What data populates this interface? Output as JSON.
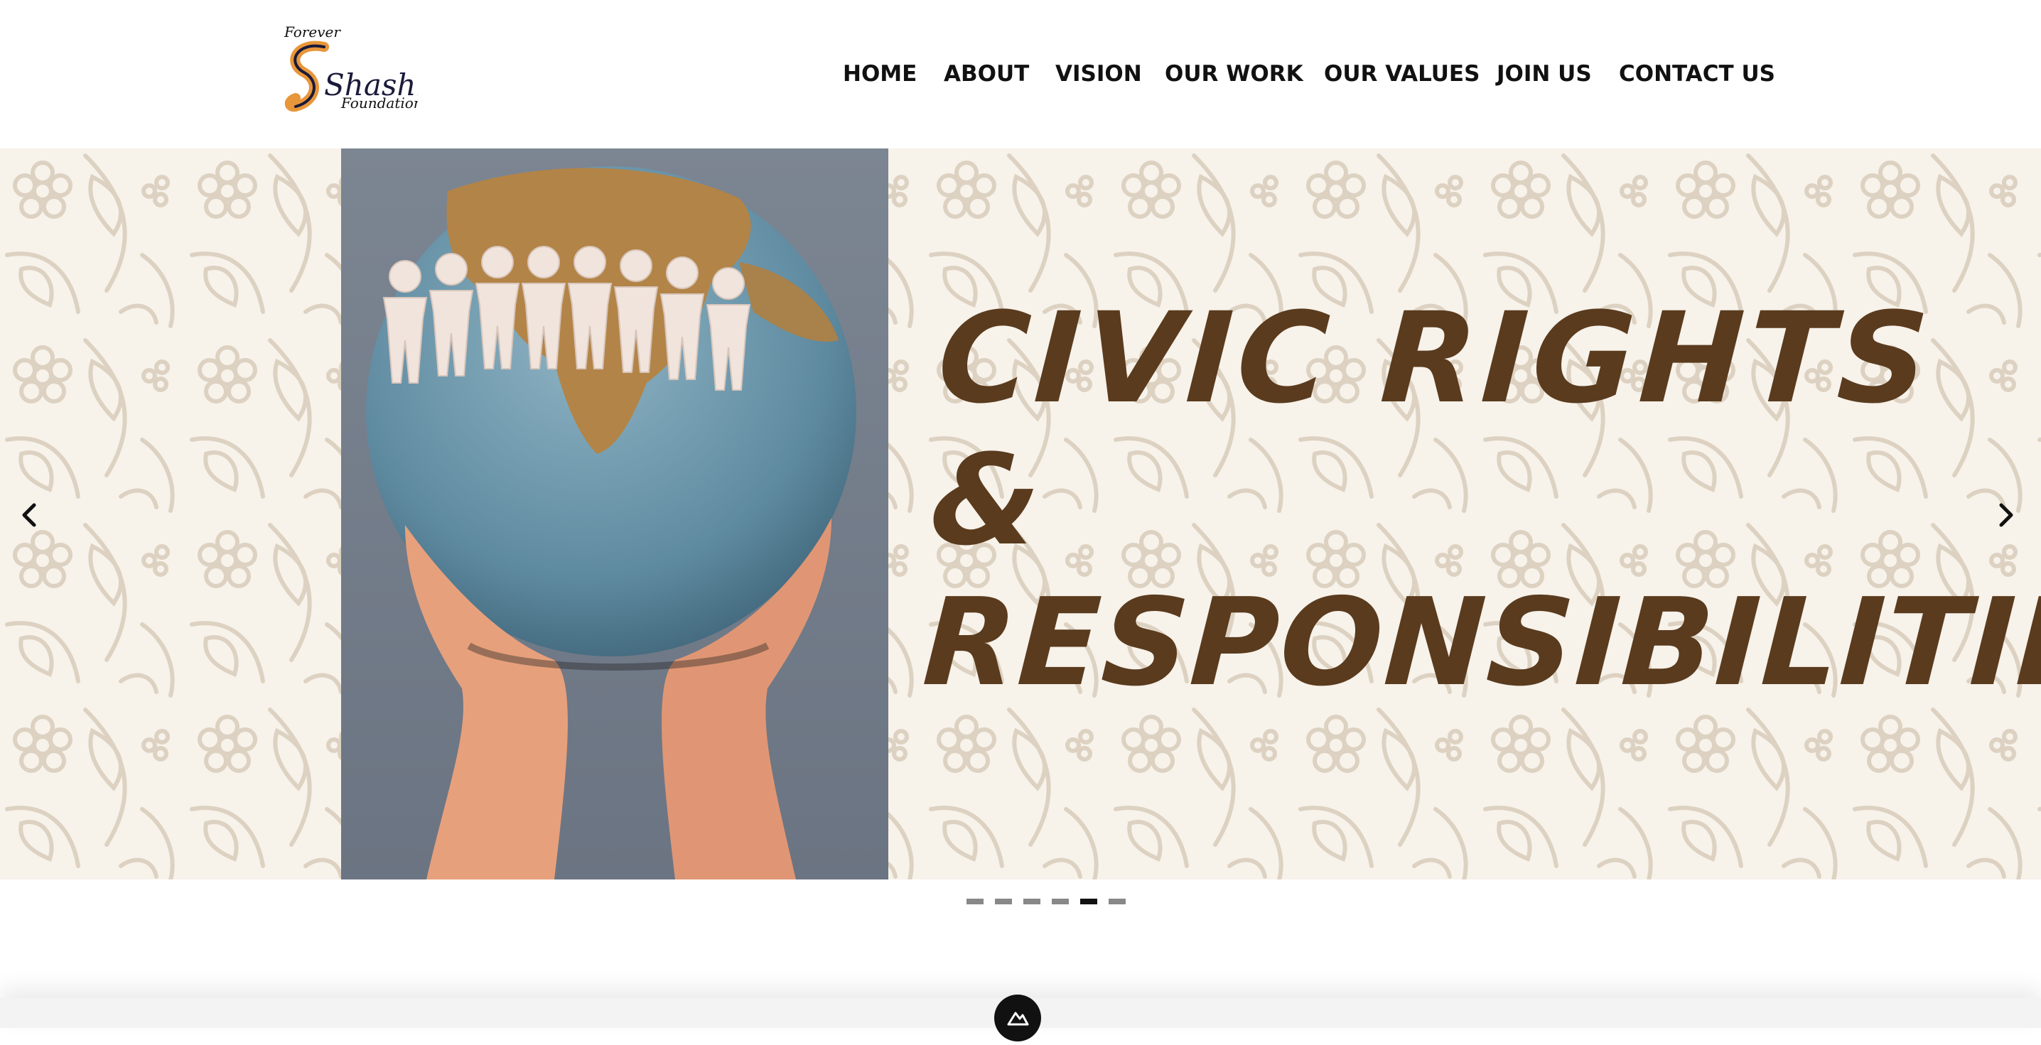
{
  "header": {
    "logo": {
      "top_text": "Forever",
      "main_text": "Shashi",
      "bottom_text": "Foundation",
      "colors": {
        "accent": "#e8963a",
        "ink": "#1a1a3a"
      }
    },
    "nav": [
      {
        "label": "HOME"
      },
      {
        "label": "ABOUT"
      },
      {
        "label": "VISION"
      },
      {
        "label": "OUR WORK"
      },
      {
        "label": "OUR VALUES"
      },
      {
        "label": "JOIN US"
      },
      {
        "label": "CONTACT US"
      }
    ]
  },
  "slider": {
    "headline_line1": "Civic Rights",
    "headline_line2": "&",
    "headline_line3": "Responsibilities",
    "text_color": "#5a3b1e",
    "background_color": "#f7f2ea",
    "pattern_color": "#ddd2c2",
    "prev_icon": "chevron-left-icon",
    "next_icon": "chevron-right-icon",
    "slide_count": 6,
    "active_slide": 5
  },
  "badge": {
    "icon": "mountain-logo-icon"
  }
}
